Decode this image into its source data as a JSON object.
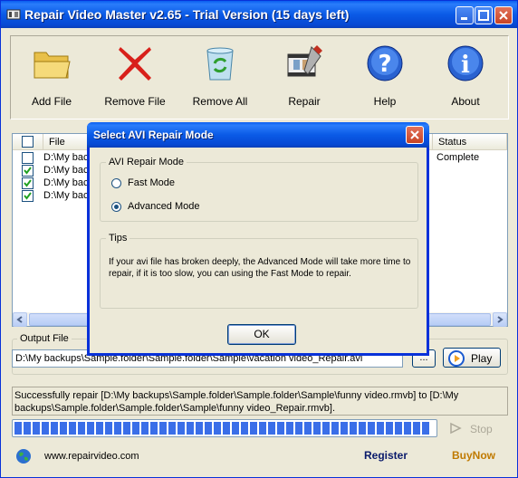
{
  "window": {
    "title": "Repair Video Master v2.65 - Trial Version (15 days left)"
  },
  "toolbar": {
    "add_file": "Add File",
    "remove_file": "Remove File",
    "remove_all": "Remove All",
    "repair": "Repair",
    "help": "Help",
    "about": "About"
  },
  "file_list": {
    "columns": [
      "File",
      "Status"
    ],
    "rows": [
      {
        "path": "D:\\My backups",
        "status": "Complete",
        "checked": false
      },
      {
        "path": "D:\\My backups",
        "status": "",
        "checked": true
      },
      {
        "path": "D:\\My backups",
        "status": "",
        "checked": true
      },
      {
        "path": "D:\\My backups",
        "status": "",
        "checked": true
      }
    ]
  },
  "output": {
    "label": "Output File",
    "value": "D:\\My backups\\Sample.folder\\Sample.folder\\Sample\\vacation video_Repair.avi",
    "browse_label": "...",
    "play_label": "Play"
  },
  "log": {
    "message": "Successfully repair [D:\\My backups\\Sample.folder\\Sample.folder\\Sample\\funny video.rmvb] to [D:\\My backups\\Sample.folder\\Sample.folder\\Sample\\funny video_Repair.rmvb]."
  },
  "progress": {
    "fraction": 1.0,
    "stop_label": "Stop"
  },
  "footer": {
    "website": "www.repairvideo.com",
    "register": "Register",
    "buynow": "BuyNow"
  },
  "dialog": {
    "title": "Select AVI Repair Mode",
    "mode_group_label": "AVI Repair Mode",
    "fast_mode": "Fast Mode",
    "advanced_mode": "Advanced Mode",
    "selected_mode": "advanced",
    "tips_label": "Tips",
    "tips_text": "If your avi file has broken deeply, the Advanced Mode will take more time to repair, if it is too slow, you can using the Fast Mode to repair.",
    "ok_label": "OK"
  },
  "colors": {
    "title_blue": "#0a5ae6",
    "progress_blue": "#3a6ee8",
    "register": "#0a1a6b",
    "buynow": "#c07a00"
  }
}
